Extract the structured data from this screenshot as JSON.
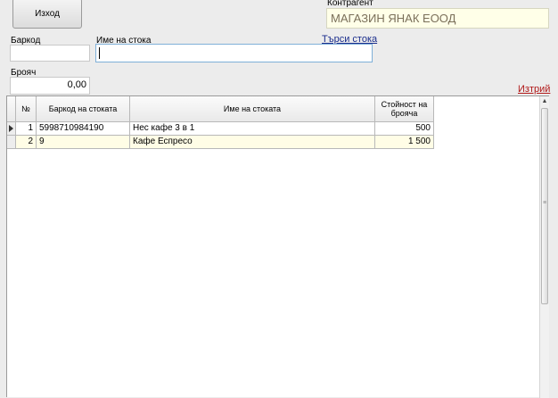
{
  "toolbar": {
    "exit_label": "Изход"
  },
  "contragent": {
    "label": "Контрагент",
    "value": "МАГАЗИН ЯНАК ЕООД"
  },
  "form": {
    "barcode_label": "Баркод",
    "barcode_value": "",
    "name_label": "Име на стока",
    "name_value": "",
    "search_link": "Търси стока",
    "qty_label": "Брояч",
    "qty_value": "0,00",
    "delete_link": "Изтрий"
  },
  "grid": {
    "columns": [
      "№",
      "Баркод на стоката",
      "Име на стоката",
      "Стойност на брояча"
    ],
    "rows": [
      {
        "no": "1",
        "barcode": "5998710984190",
        "name": "Нес кафе 3 в 1",
        "value": "500"
      },
      {
        "no": "2",
        "barcode": "9",
        "name": "Кафе Еспресо",
        "value": "1 500"
      }
    ]
  }
}
